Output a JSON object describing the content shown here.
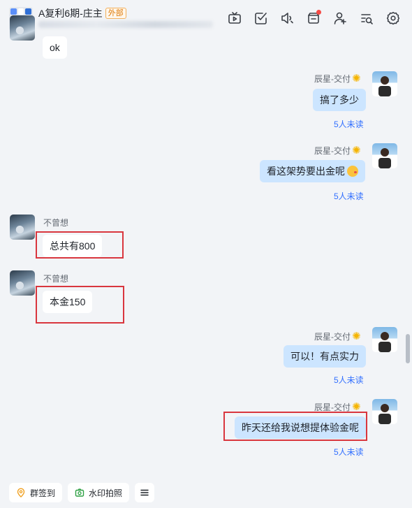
{
  "header": {
    "title": "A复利6期-庄主",
    "external_tag": "外部",
    "tools": [
      {
        "icon": "tv-icon"
      },
      {
        "icon": "checkbox-icon"
      },
      {
        "icon": "announcement-icon"
      },
      {
        "icon": "message-card-icon",
        "has_badge": true
      },
      {
        "icon": "add-member-icon"
      },
      {
        "icon": "search-history-icon"
      },
      {
        "icon": "settings-icon"
      }
    ]
  },
  "messages": [
    {
      "side": "left",
      "sender": "",
      "text": "ok"
    },
    {
      "side": "right",
      "sender": "辰星-交付",
      "text": "搞了多少",
      "status": "5人未读"
    },
    {
      "side": "right",
      "sender": "辰星-交付",
      "text": "看这架势要出金呢",
      "emoji": "wink-kiss-emoji",
      "status": "5人未读"
    },
    {
      "side": "left",
      "sender": "不曾想",
      "text": "总共有800"
    },
    {
      "side": "left",
      "sender": "不曾想",
      "text": "本金150"
    },
    {
      "side": "right",
      "sender": "辰星-交付",
      "text": "可以！有点实力",
      "status": "5人未读"
    },
    {
      "side": "right",
      "sender": "辰星-交付",
      "text": "昨天还给我说想提体验金呢",
      "status": "5人未读"
    }
  ],
  "footer": {
    "checkin_label": "群签到",
    "watermark_label": "水印拍照",
    "more_icon": "menu-icon"
  },
  "colors": {
    "accent": "#3370ff",
    "bubble_self": "#cce5ff",
    "highlight": "#d9363e",
    "external_tag": "#de7802"
  }
}
